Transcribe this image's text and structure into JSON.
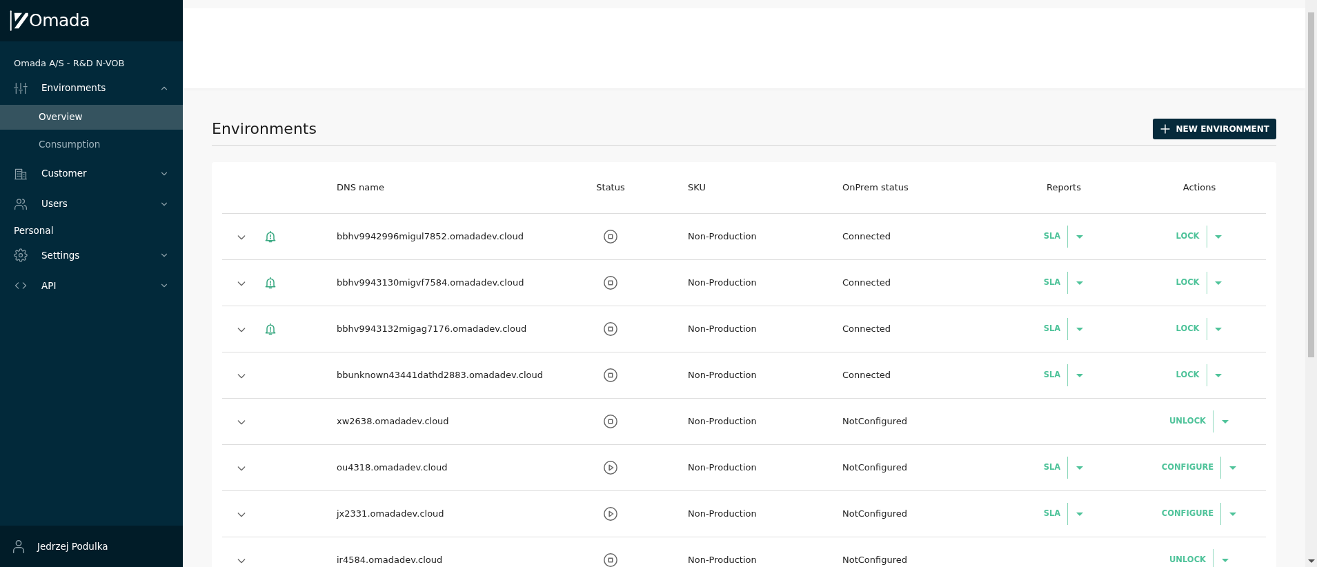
{
  "sidebar": {
    "logo": "Omada",
    "org": "Omada A/S - R&D N-VOB",
    "nav": [
      {
        "label": "Environments",
        "expanded": true,
        "children": [
          {
            "label": "Overview",
            "selected": true
          },
          {
            "label": "Consumption",
            "selected": false
          }
        ]
      },
      {
        "label": "Customer",
        "expanded": false
      },
      {
        "label": "Users",
        "expanded": false
      }
    ],
    "section": "Personal",
    "personal_nav": [
      {
        "label": "Settings",
        "expanded": false
      },
      {
        "label": "API",
        "expanded": false
      }
    ],
    "user": "Jedrzej Podulka"
  },
  "page": {
    "title": "Environments",
    "new_button": "NEW ENVIRONMENT"
  },
  "table": {
    "columns": [
      "DNS name",
      "Status",
      "SKU",
      "OnPrem status",
      "Reports",
      "Actions"
    ],
    "rows": [
      {
        "alert": true,
        "dns": "bbhv9942996migul7852.omadadev.cloud",
        "running": false,
        "sku": "Non-Production",
        "onprem": "Connected",
        "report": "SLA",
        "action": "LOCK"
      },
      {
        "alert": true,
        "dns": "bbhv9943130migvf7584.omadadev.cloud",
        "running": false,
        "sku": "Non-Production",
        "onprem": "Connected",
        "report": "SLA",
        "action": "LOCK"
      },
      {
        "alert": true,
        "dns": "bbhv9943132migag7176.omadadev.cloud",
        "running": false,
        "sku": "Non-Production",
        "onprem": "Connected",
        "report": "SLA",
        "action": "LOCK"
      },
      {
        "alert": false,
        "dns": "bbunknown43441dathd2883.omadadev.cloud",
        "running": false,
        "sku": "Non-Production",
        "onprem": "Connected",
        "report": "SLA",
        "action": "LOCK"
      },
      {
        "alert": false,
        "dns": "xw2638.omadadev.cloud",
        "running": false,
        "sku": "Non-Production",
        "onprem": "NotConfigured",
        "action": "UNLOCK"
      },
      {
        "alert": false,
        "dns": "ou4318.omadadev.cloud",
        "running": true,
        "sku": "Non-Production",
        "onprem": "NotConfigured",
        "report": "SLA",
        "action": "CONFIGURE"
      },
      {
        "alert": false,
        "dns": "jx2331.omadadev.cloud",
        "running": true,
        "sku": "Non-Production",
        "onprem": "NotConfigured",
        "report": "SLA",
        "action": "CONFIGURE"
      },
      {
        "alert": false,
        "dns": "ir4584.omadadev.cloud",
        "running": false,
        "sku": "Non-Production",
        "onprem": "NotConfigured",
        "action": "UNLOCK"
      }
    ]
  }
}
